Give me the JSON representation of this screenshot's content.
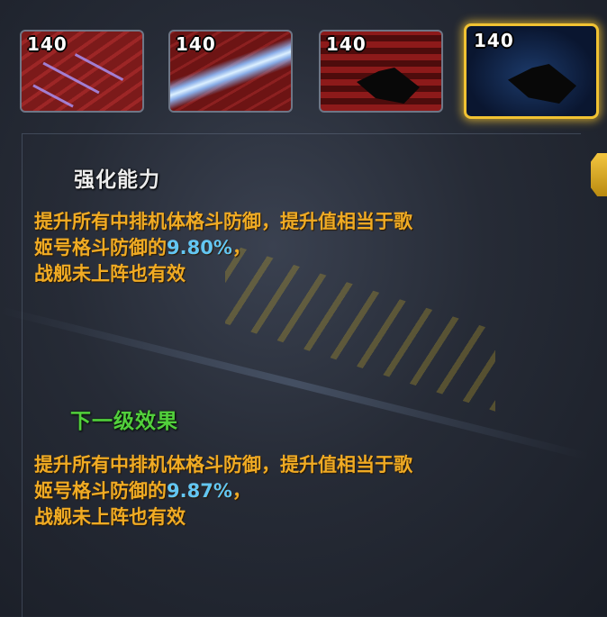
{
  "skills": [
    {
      "level": "140",
      "selected": false
    },
    {
      "level": "140",
      "selected": false
    },
    {
      "level": "140",
      "selected": false
    },
    {
      "level": "140",
      "selected": true
    }
  ],
  "current": {
    "title": "强化能力",
    "line1": "提升所有中排机体格斗防御，提升值相当于歌",
    "line2_prefix": "姬号格斗防御的",
    "percent": "9.80%",
    "line2_suffix": "，",
    "line3": "战舰未上阵也有效"
  },
  "next": {
    "title": "下一级效果",
    "line1": "提升所有中排机体格斗防御，提升值相当于歌",
    "line2_prefix": "姬号格斗防御的",
    "percent": "9.87%",
    "line2_suffix": "，",
    "line3": "战舰未上阵也有效"
  },
  "colors": {
    "accent_gold": "#f1c232",
    "desc_orange": "#f0ab24",
    "percent_blue": "#63c6f2",
    "next_green": "#52d03c"
  }
}
